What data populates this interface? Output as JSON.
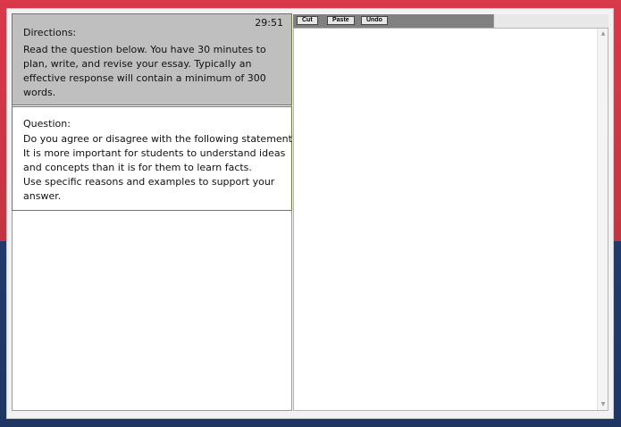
{
  "timer": "29:51",
  "directions": {
    "title": "Directions:",
    "lines": [
      "Read the question below.  You have 30 minutes to",
      "plan, write, and revise your essay.  Typically an",
      "effective response will contain a minimum of 300",
      "words."
    ]
  },
  "question": {
    "title": "Question:",
    "lines": [
      "Do you agree or disagree with the following statement?",
      "It is more important for students to understand ideas",
      "and concepts than it is for them to learn facts.",
      "Use specific reasons and examples to support your",
      "answer."
    ]
  },
  "toolbar": {
    "cut_label": "Cut",
    "paste_label": "Paste",
    "undo_label": "Undo"
  },
  "editor": {
    "value": ""
  },
  "icons": {
    "scroll_up": "triangle-up",
    "scroll_down": "triangle-down"
  },
  "colors": {
    "background_top": "#d9394a",
    "background_bottom": "#243a6a",
    "directions_bg": "#bfbfbf",
    "panel_border": "#6f7f3f",
    "toolbar_bg": "#808080"
  }
}
